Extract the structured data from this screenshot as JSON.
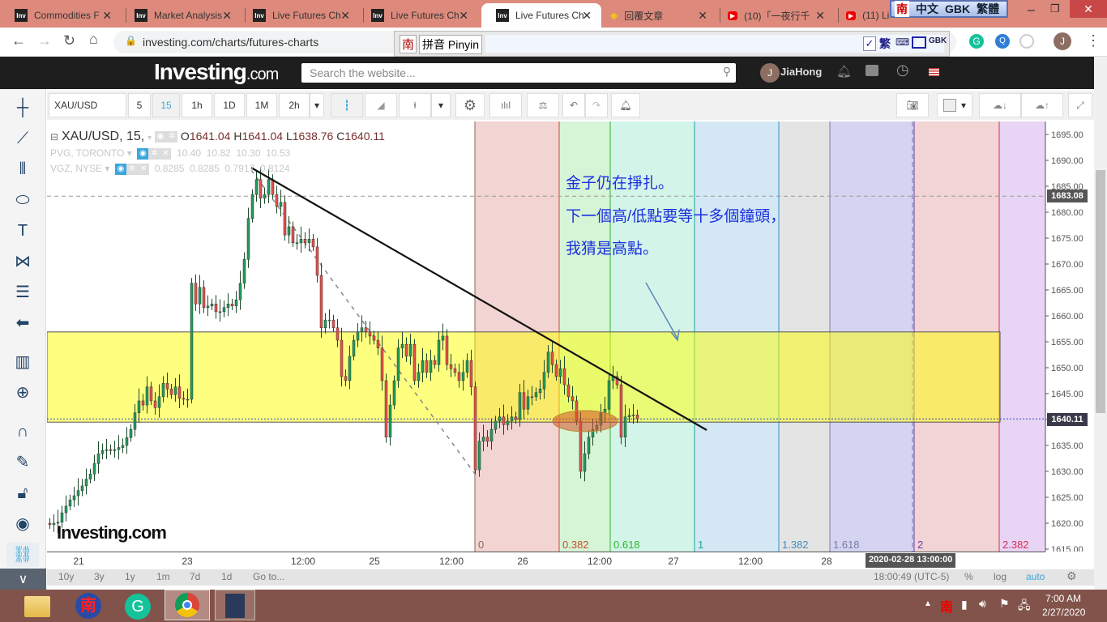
{
  "browser": {
    "tabs": [
      {
        "label": "Commodities F",
        "icon": "investing-favicon"
      },
      {
        "label": "Market Analysis",
        "icon": "investing-favicon"
      },
      {
        "label": "Live Futures Ch",
        "icon": "investing-favicon"
      },
      {
        "label": "Live Futures Ch",
        "icon": "investing-favicon"
      },
      {
        "label": "Live Futures Ch",
        "icon": "investing-favicon",
        "active": true
      },
      {
        "label": "回覆文章",
        "icon": "diamond-icon"
      },
      {
        "label": "(10)「一夜行千",
        "icon": "youtube-icon"
      },
      {
        "label": "(11) Li",
        "icon": "youtube-icon"
      }
    ],
    "url": "investing.com/charts/futures-charts",
    "ime_label": "拼音 Pinyin",
    "ime_logo": "南",
    "ime_bar": [
      "中文",
      "GBK",
      "繁體"
    ],
    "ime_buttons": [
      "繁",
      "GBK"
    ],
    "profile_initial": "J"
  },
  "site": {
    "logo_main": "Investing",
    "logo_suffix": ".com",
    "search_placeholder": "Search the website...",
    "user_initial": "J",
    "user_name": "JiaHong"
  },
  "toolbar": {
    "symbol": "XAU/USD",
    "intervals": [
      "5",
      "15",
      "1h",
      "1D",
      "1M",
      "2h"
    ],
    "active_interval": "15"
  },
  "legend": {
    "main": {
      "symbol": "XAU/USD, 15,",
      "o_label": "O",
      "o": "1641.04",
      "h_label": "H",
      "h": "1641.04",
      "l_label": "L",
      "l": "1638.76",
      "c_label": "C",
      "c": "1640.11"
    },
    "overlays": [
      {
        "name": "PVG, TORONTO",
        "values": [
          "10.40",
          "10.82",
          "10.30",
          "10.53"
        ]
      },
      {
        "name": "VGZ, NYSE",
        "values": [
          "0.8285",
          "0.8285",
          "0.7917",
          "0.8124"
        ]
      }
    ]
  },
  "annotations": [
    "金子仍在掙扎。",
    "下一個高/低點要等十多個鐘頭，",
    "我猜是高點。"
  ],
  "watermark": "Investing.com",
  "chart_data": {
    "type": "candlestick",
    "symbol": "XAU/USD",
    "interval": "15",
    "ylim": [
      1615,
      1697
    ],
    "y_ticks": [
      "1695.00",
      "1690.00",
      "1685.00",
      "1680.00",
      "1675.00",
      "1670.00",
      "1665.00",
      "1660.00",
      "1655.00",
      "1650.00",
      "1645.00",
      "1640.00",
      "1635.00",
      "1630.00",
      "1625.00",
      "1620.00",
      "1615.00"
    ],
    "x_ticks": [
      "21",
      "23",
      "12:00",
      "25",
      "12:00",
      "26",
      "12:00",
      "27",
      "12:00",
      "28"
    ],
    "closes": [
      1619.7,
      1620.0,
      1620.2,
      1622.0,
      1623.3,
      1624.5,
      1625.3,
      1626.3,
      1627.2,
      1628.5,
      1629.5,
      1631.5,
      1633.4,
      1634.0,
      1634.2,
      1634.0,
      1634.2,
      1634.6,
      1635.0,
      1636.5,
      1638.1,
      1641.3,
      1643.6,
      1642.8,
      1646.3,
      1643.6,
      1642.3,
      1644.4,
      1647.0,
      1645.9,
      1644.8,
      1646.3,
      1644.1,
      1643.9,
      1643.9,
      1666.3,
      1662.3,
      1665.5,
      1661.6,
      1661.9,
      1662.3,
      1660.8,
      1660.8,
      1661.6,
      1662.3,
      1661.9,
      1663.1,
      1666.3,
      1670.9,
      1678.8,
      1683.4,
      1686.3,
      1682.7,
      1683.4,
      1686.3,
      1683.4,
      1681.1,
      1681.9,
      1675.6,
      1677.2,
      1674.1,
      1674.1,
      1674.8,
      1674.1,
      1674.8,
      1673.3,
      1667.8,
      1657.7,
      1659.2,
      1659.2,
      1657.7,
      1655.3,
      1648.3,
      1647.5,
      1652.2,
      1655.3,
      1656.9,
      1657.7,
      1656.9,
      1656.1,
      1655.3,
      1653.8,
      1647.5,
      1636.6,
      1642.8,
      1647.5,
      1653.8,
      1654.5,
      1652.2,
      1654.5,
      1647.5,
      1649.1,
      1651.4,
      1649.1,
      1651.4,
      1650.6,
      1655.3,
      1656.1,
      1650.6,
      1649.8,
      1649.1,
      1647.5,
      1649.1,
      1651.4,
      1646.3,
      1630.3,
      1635.8,
      1636.6,
      1635.8,
      1638.1,
      1639.7,
      1640.5,
      1639.0,
      1639.7,
      1640.5,
      1640.0,
      1645.2,
      1642.0,
      1644.4,
      1644.4,
      1645.2,
      1645.9,
      1649.1,
      1653.0,
      1650.6,
      1648.3,
      1649.8,
      1646.7,
      1644.4,
      1643.6,
      1639.7,
      1630.0,
      1633.4,
      1636.6,
      1638.1,
      1638.9,
      1641.3,
      1642.0,
      1647.5,
      1648.3,
      1646.7,
      1636.6,
      1640.5,
      1640.8,
      1640.9,
      1640.11
    ],
    "last_price": "1640.11",
    "marked_price": "1683.08",
    "zone": [
      1639.5,
      1656.9
    ],
    "colors": {
      "up": "#1e9e5a",
      "down": "#e9504a",
      "zone": "#ffff80"
    },
    "fib_time_zones": [
      {
        "label": "0",
        "color": "#8a6a5a",
        "fill": "#f2d4d2"
      },
      {
        "label": "0.382",
        "color": "#c0522a",
        "fill": "#d6f4d6"
      },
      {
        "label": "0.618",
        "color": "#2db82d",
        "fill": "#d3f4e8"
      },
      {
        "label": "1",
        "color": "#1aa89a",
        "fill": "#d3e8f4"
      },
      {
        "label": "1.382",
        "color": "#3a8fc4",
        "fill": "#e4e4e4"
      },
      {
        "label": "1.618",
        "color": "#7a7aa8",
        "fill": "#d4d4f2"
      },
      {
        "label": "2",
        "color": "#6a3ab0",
        "fill": "#f2d4d4"
      },
      {
        "label": "2.382",
        "color": "#d0305a",
        "fill": "#e8d4f4"
      }
    ],
    "crosshair_time": "2020-02-28 13:00:00"
  },
  "bottom": {
    "ranges": [
      "10y",
      "3y",
      "1y",
      "1m",
      "7d",
      "1d",
      "Go to..."
    ],
    "clock": "18:00:49 (UTC-5)",
    "options": [
      "%",
      "log",
      "auto"
    ]
  },
  "taskbar": {
    "time": "7:00 AM",
    "date": "2/27/2020",
    "tray_ime": "南"
  }
}
